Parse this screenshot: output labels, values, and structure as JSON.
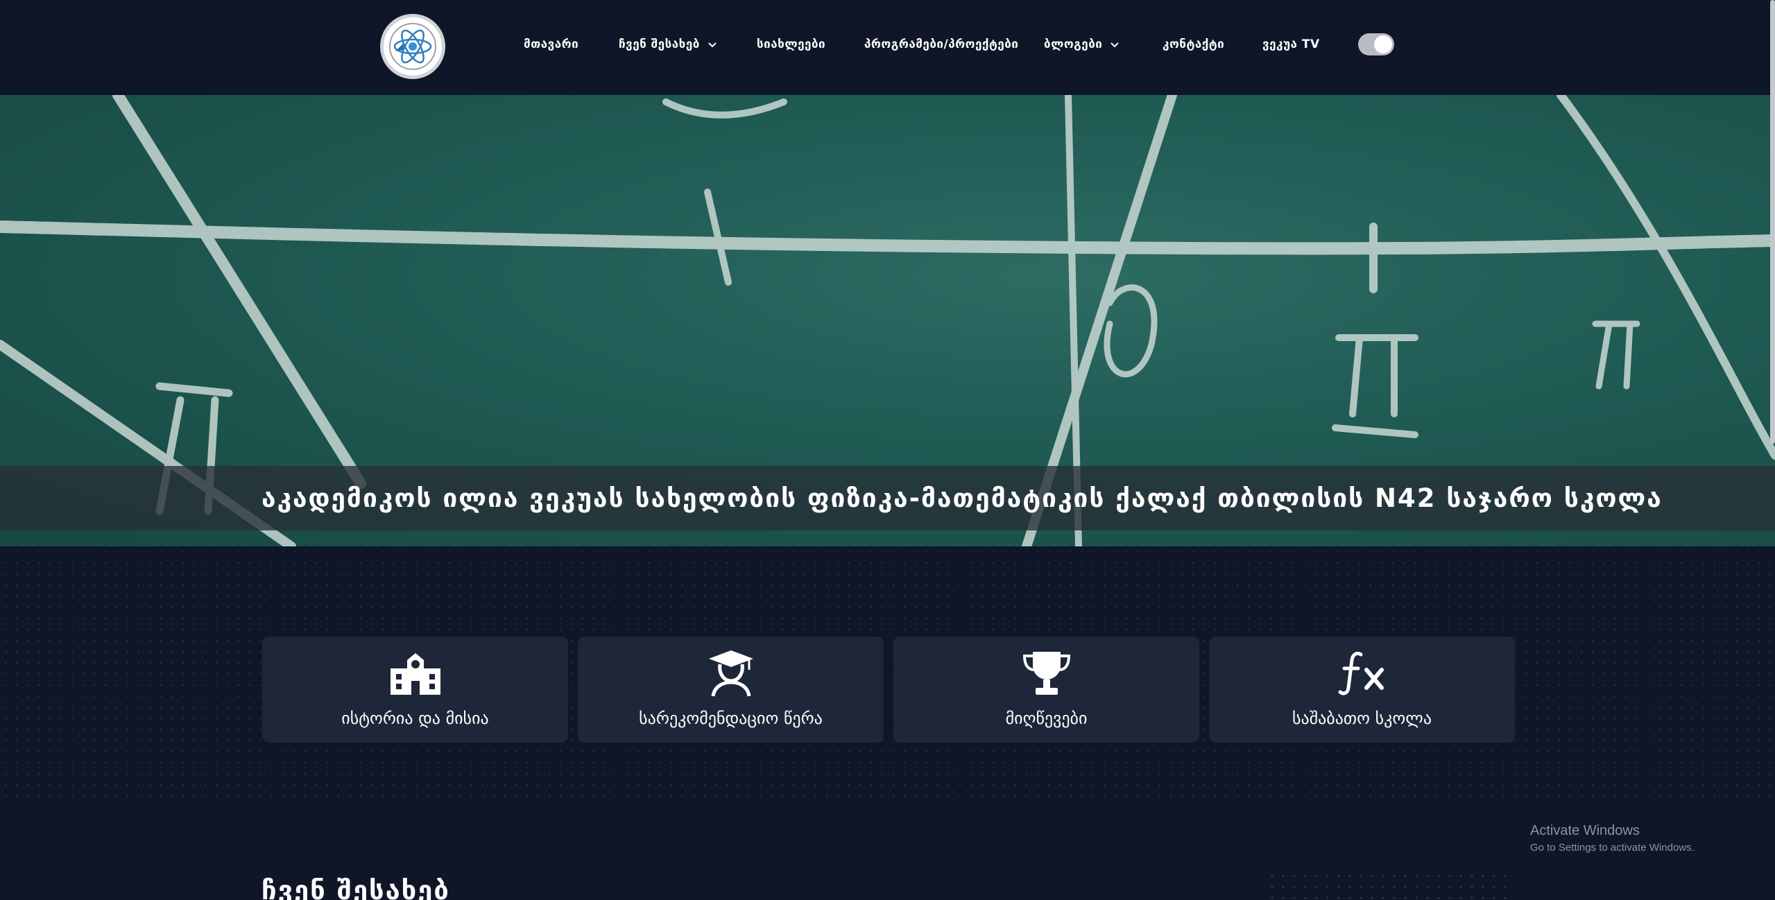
{
  "header": {
    "nav": [
      {
        "label": "მთავარი",
        "dropdown": false
      },
      {
        "label": "ჩვენ შესახებ",
        "dropdown": true
      },
      {
        "label": "სიახლეები",
        "dropdown": false
      },
      {
        "label": "პროგრამები/პროექტები",
        "dropdown": false
      },
      {
        "label": "ბლოგები",
        "dropdown": true
      },
      {
        "label": "კონტაქტი",
        "dropdown": false
      },
      {
        "label": "ვეკუა TV",
        "dropdown": false
      }
    ],
    "theme_toggle_on": true
  },
  "hero": {
    "title": "აკადემიკოს ილია ვეკუას სახელობის ფიზიკა-მათემატიკის ქალაქ თბილისის N42 საჯარო სკოლა"
  },
  "cards": [
    {
      "label": "ისტორია და მისია",
      "icon": "school-building-icon"
    },
    {
      "label": "სარეკომენდაციო წერა",
      "icon": "graduate-icon"
    },
    {
      "label": "მიღწევები",
      "icon": "trophy-icon"
    },
    {
      "label": "საშაბათო სკოლა",
      "icon": "function-icon"
    }
  ],
  "section": {
    "title": "ჩვენ შესახებ"
  },
  "watermark": {
    "line1": "Activate Windows",
    "line2": "Go to Settings to activate Windows."
  },
  "colors": {
    "background": "#0f1628",
    "card": "#1e2739",
    "hero": "#1f5a53"
  }
}
